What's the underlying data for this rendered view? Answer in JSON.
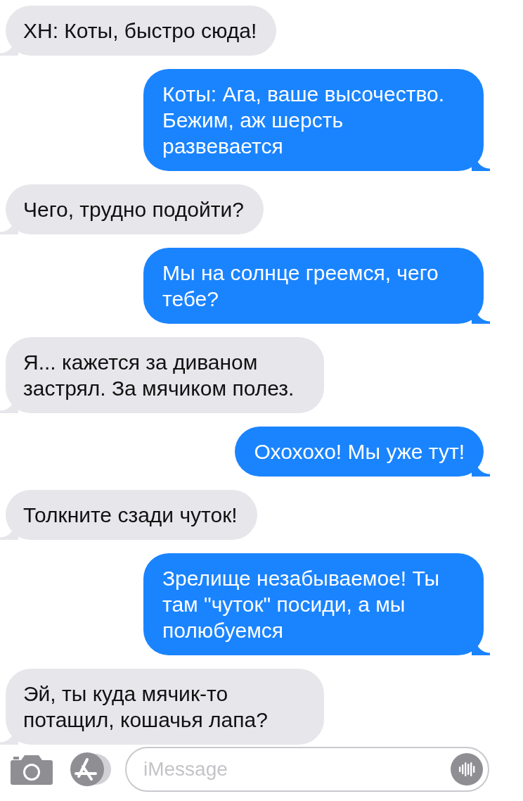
{
  "messages": [
    {
      "kind": "incoming",
      "text": "ХН: Коты, быстро сюда!"
    },
    {
      "kind": "outgoing",
      "text": "Коты: Ага, ваше высочество. Бежим, аж шерсть развевается"
    },
    {
      "kind": "incoming",
      "text": "Чего, трудно подойти?"
    },
    {
      "kind": "outgoing",
      "text": "Мы на солнце греемся, чего тебе?"
    },
    {
      "kind": "incoming",
      "text": "Я... кажется за диваном застрял. За мячиком полез."
    },
    {
      "kind": "outgoing",
      "text": "Охохохо! Мы уже тут!"
    },
    {
      "kind": "incoming",
      "text": "Толкните сзади чуток!"
    },
    {
      "kind": "outgoing",
      "text": "Зрелище незабываемое! Ты там \"чуток\" посиди, а мы полюбуемся"
    },
    {
      "kind": "incoming",
      "text": "Эй, ты куда мячик-то потащил, кошачья лапа?"
    }
  ],
  "composer": {
    "placeholder": "iMessage"
  }
}
